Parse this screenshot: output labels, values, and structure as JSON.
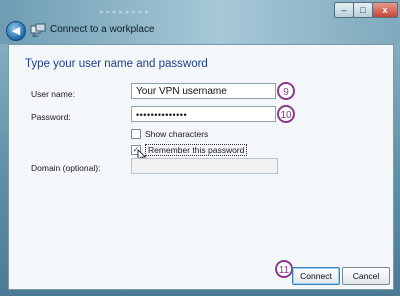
{
  "window": {
    "title": "Connect to a workplace",
    "controls": {
      "minimize": "–",
      "maximize": "□",
      "close": "x"
    },
    "back_glyph": "◀"
  },
  "form": {
    "heading": "Type your user name and password",
    "username_label": "User name:",
    "username_value": "Your VPN username",
    "password_label": "Password:",
    "password_value": "••••••••••••••",
    "show_characters_label": "Show characters",
    "show_characters_checked": false,
    "remember_label": "Remember this password",
    "remember_checked": true,
    "remember_mark": "✓",
    "domain_label": "Domain (optional):",
    "domain_value": ""
  },
  "buttons": {
    "connect": "Connect",
    "cancel": "Cancel"
  },
  "annotations": [
    "9",
    "10",
    "11"
  ],
  "colors": {
    "heading": "#1f3e8c",
    "annotation": "#8a3a8e",
    "accent": "#1d68a8"
  },
  "icons": [
    "back-arrow-icon",
    "network-icon",
    "mouse-cursor-icon",
    "checkmark-icon"
  ]
}
